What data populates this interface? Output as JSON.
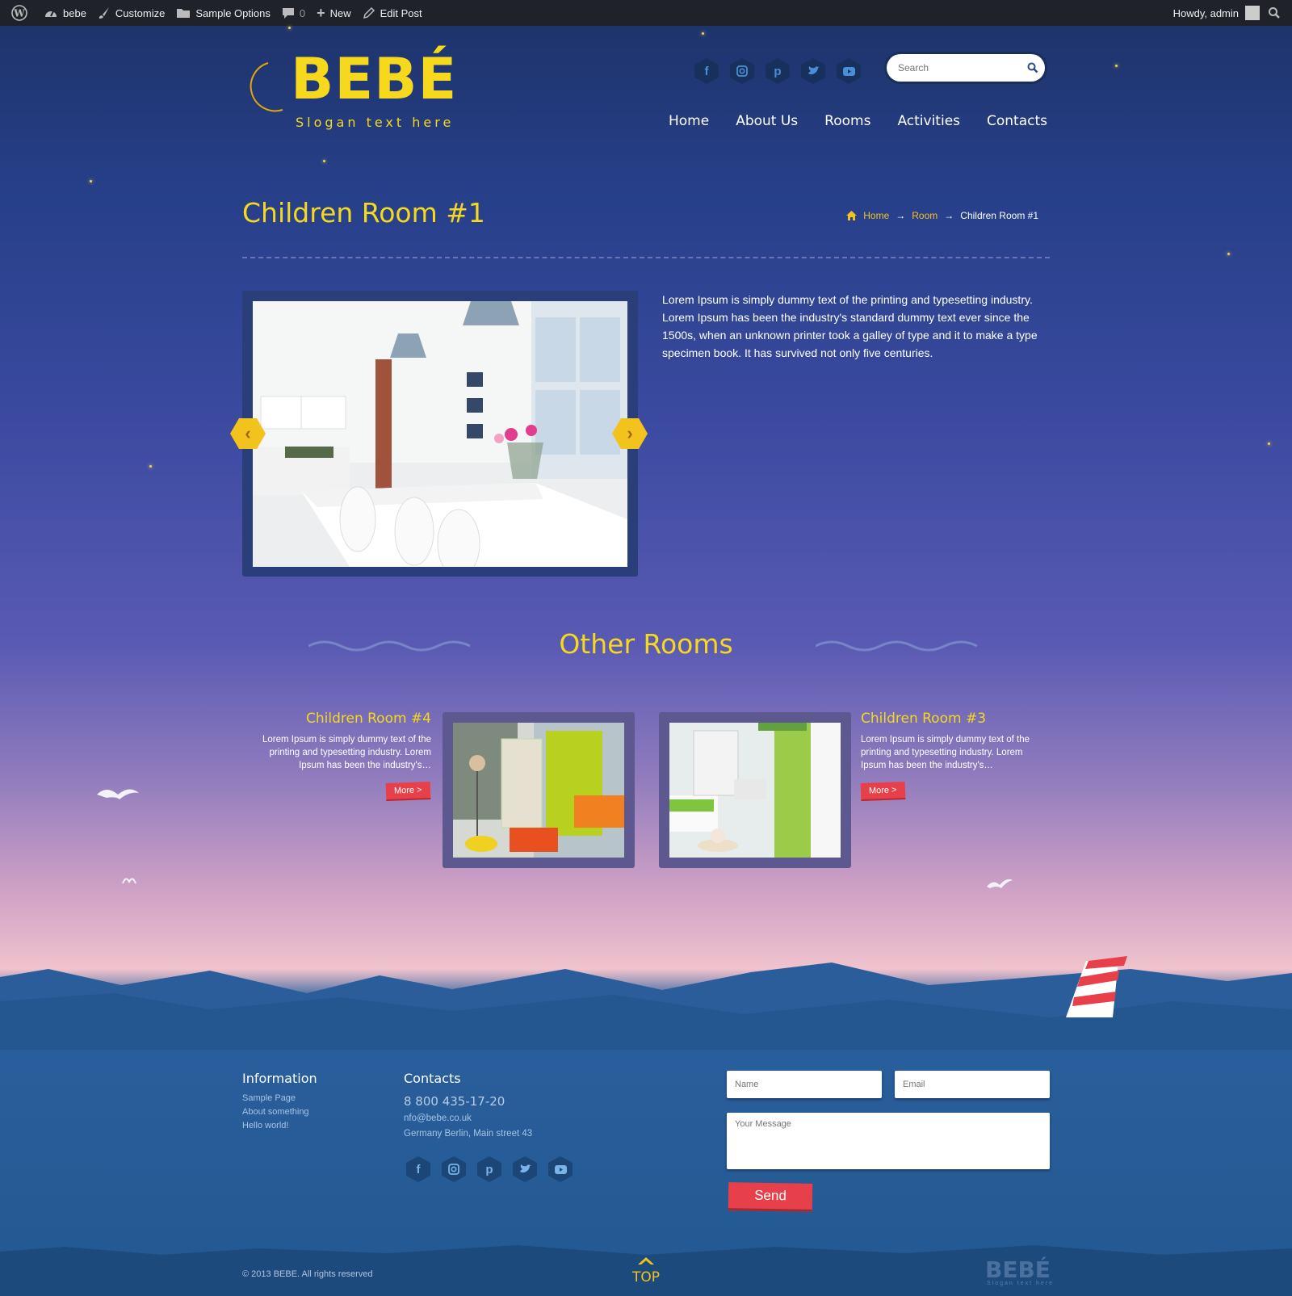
{
  "admin_bar": {
    "site": "bebe",
    "customize": "Customize",
    "sample_options": "Sample Options",
    "comments": "0",
    "new": "New",
    "edit_post": "Edit Post",
    "greeting": "Howdy, admin"
  },
  "logo": {
    "title": "BEBÉ",
    "slogan": "Slogan text here"
  },
  "social_icons": [
    "facebook-icon",
    "instagram-icon",
    "pinterest-icon",
    "twitter-icon",
    "youtube-icon"
  ],
  "search": {
    "placeholder": "Search"
  },
  "nav": {
    "home": "Home",
    "about": "About Us",
    "rooms": "Rooms",
    "activities": "Activities",
    "contacts": "Contacts"
  },
  "page": {
    "title": "Children Room #1",
    "breadcrumb": {
      "home": "Home",
      "room": "Room",
      "current": "Children Room #1",
      "sep": "→"
    },
    "description": "Lorem Ipsum is simply dummy text of the printing and typesetting industry. Lorem Ipsum has been the industry's standard dummy text ever since the 1500s, when an unknown printer took a galley of type and it to make a type specimen book. It has survived not only five centuries.",
    "prev": "‹",
    "next": "›"
  },
  "other_rooms": {
    "heading": "Other Rooms",
    "items": [
      {
        "title": "Children Room #4",
        "text": "Lorem Ipsum is simply dummy text of the printing and typesetting industry. Lorem Ipsum has been the industry's…",
        "more": "More >"
      },
      {
        "title": "Children Room #3",
        "text": "Lorem Ipsum is simply dummy text of the printing and typesetting industry. Lorem Ipsum has been the industry's…",
        "more": "More >"
      }
    ]
  },
  "footer": {
    "information": {
      "heading": "Information",
      "links": [
        "Sample Page",
        "About something",
        "Hello world!"
      ]
    },
    "contacts": {
      "heading": "Contacts",
      "phone": "8 800 435-17-20",
      "email": "nfo@bebe.co.uk",
      "address": "Germany Berlin, Main street 43"
    },
    "form": {
      "name_placeholder": "Name",
      "email_placeholder": "Email",
      "message_placeholder": "Your Message",
      "send": "Send"
    },
    "copyright": "© 2013 BEBE. All rights reserved",
    "top": "TOP",
    "logo_title": "BEBÉ",
    "logo_slogan": "Slogan text here"
  },
  "colors": {
    "accent_yellow": "#f6d81c",
    "button_red": "#e8404a",
    "admin_bar": "#1f2329"
  }
}
